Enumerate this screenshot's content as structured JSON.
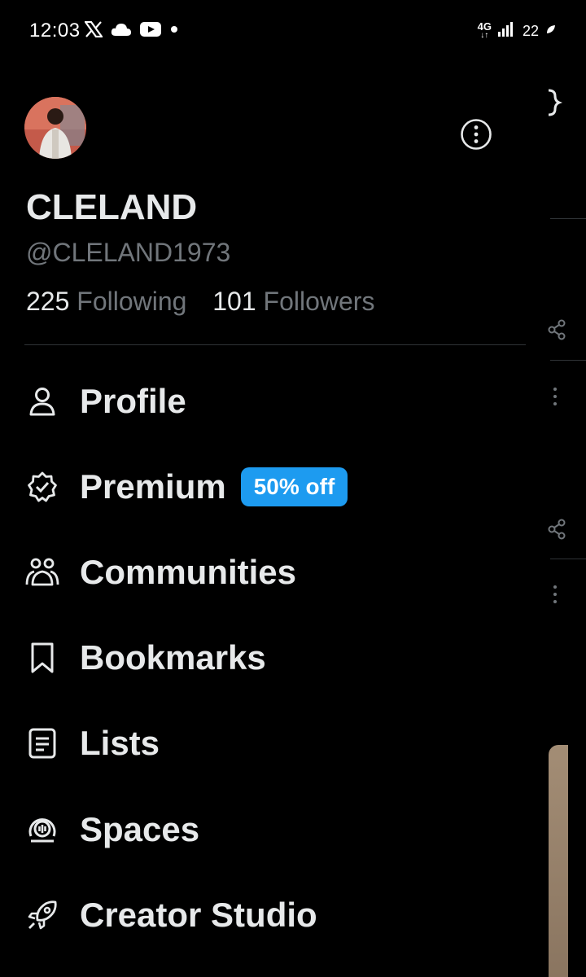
{
  "status_bar": {
    "time": "12:03",
    "network_top": "4G",
    "network_bottom": "↓↑",
    "battery": "22"
  },
  "profile": {
    "display_name": "CLELAND",
    "handle": "@CLELAND1973",
    "following_count": "225",
    "following_label": "Following",
    "followers_count": "101",
    "followers_label": "Followers"
  },
  "menu": {
    "items": [
      {
        "label": "Profile",
        "icon": "person-icon"
      },
      {
        "label": "Premium",
        "icon": "verified-badge-icon",
        "badge": "50% off"
      },
      {
        "label": "Communities",
        "icon": "communities-icon"
      },
      {
        "label": "Bookmarks",
        "icon": "bookmark-icon"
      },
      {
        "label": "Lists",
        "icon": "list-icon"
      },
      {
        "label": "Spaces",
        "icon": "spaces-icon"
      },
      {
        "label": "Creator Studio",
        "icon": "rocket-icon"
      }
    ]
  },
  "colors": {
    "background": "#000000",
    "text_primary": "#e7e9ea",
    "text_secondary": "#71767b",
    "accent": "#1d9bf0",
    "divider": "#2f3336"
  }
}
